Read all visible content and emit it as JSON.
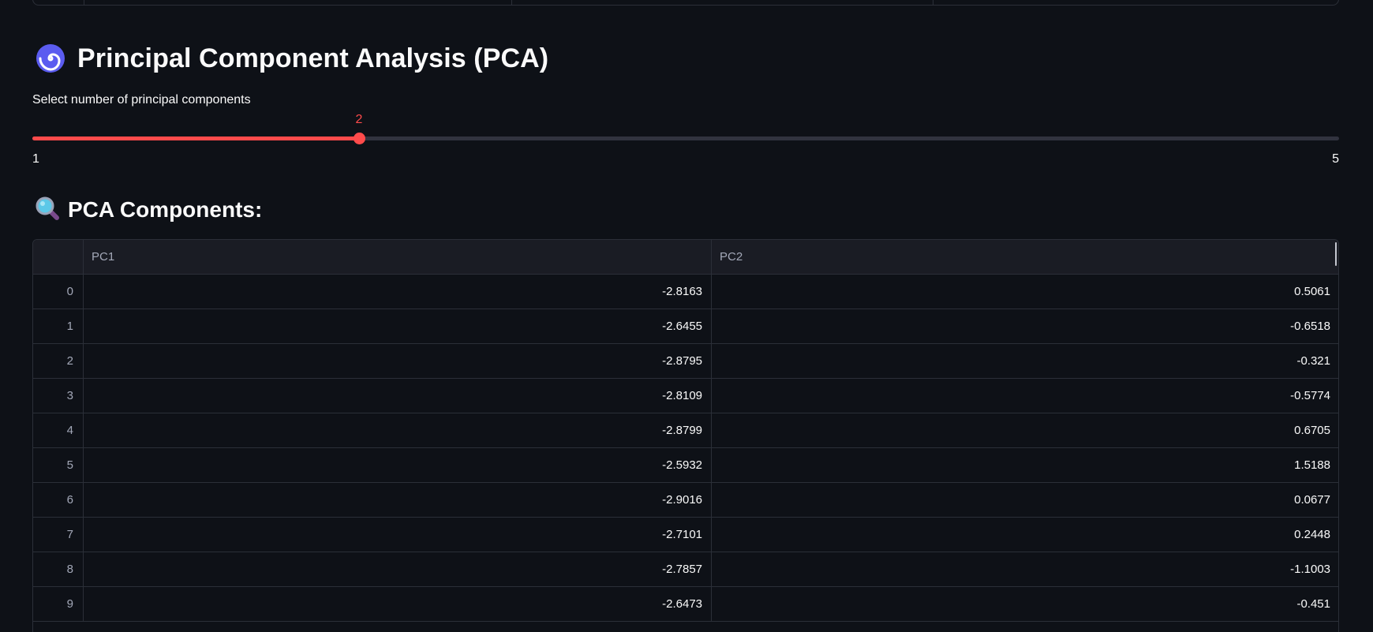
{
  "title": {
    "icon": "cyclone-icon",
    "text": "Principal Component Analysis (PCA)"
  },
  "slider": {
    "label": "Select number of principal components",
    "value": 2,
    "value_text": "2",
    "min": 1,
    "max": 5,
    "min_text": "1",
    "max_text": "5",
    "accent_color": "#ff4b4b"
  },
  "components_heading": {
    "icon": "magnifying-glass-icon",
    "text": "PCA Components:"
  },
  "table": {
    "columns": [
      "PC1",
      "PC2"
    ],
    "rows": [
      {
        "index": "0",
        "pc1": "-2.8163",
        "pc2": "0.5061"
      },
      {
        "index": "1",
        "pc1": "-2.6455",
        "pc2": "-0.6518"
      },
      {
        "index": "2",
        "pc1": "-2.8795",
        "pc2": "-0.321"
      },
      {
        "index": "3",
        "pc1": "-2.8109",
        "pc2": "-0.5774"
      },
      {
        "index": "4",
        "pc1": "-2.8799",
        "pc2": "0.6705"
      },
      {
        "index": "5",
        "pc1": "-2.5932",
        "pc2": "1.5188"
      },
      {
        "index": "6",
        "pc1": "-2.9016",
        "pc2": "0.0677"
      },
      {
        "index": "7",
        "pc1": "-2.7101",
        "pc2": "0.2448"
      },
      {
        "index": "8",
        "pc1": "-2.7857",
        "pc2": "-1.1003"
      },
      {
        "index": "9",
        "pc1": "-2.6473",
        "pc2": "-0.451"
      }
    ]
  },
  "colors": {
    "background": "#0e1117",
    "text": "#fafafa",
    "border": "#2b2f38"
  }
}
